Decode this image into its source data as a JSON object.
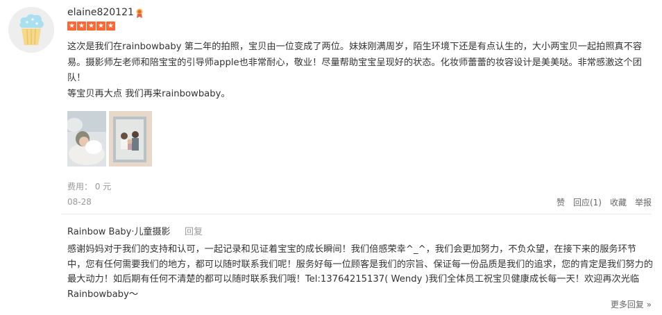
{
  "review": {
    "username": "elaine820121",
    "vip_icon": "vip-badge-icon",
    "rating": 5,
    "text_lines": [
      "这次是我们在rainbowbaby 第二年的拍照，宝贝由一位变成了两位。妹妹刚满周岁，陌生环境下还是有点认生的，大小两宝贝一起拍照真不容易。摄影师左老师和陪宝宝的引导师apple也非常耐心，敬业！尽量帮助宝宝呈现好的状态。化妆师蕾蕾的妆容设计是美美哒。非常感激这个团队！",
      "等宝贝再大点 我们再来rainbowbaby。"
    ],
    "cost": "费用： 0 元",
    "date": "08-28",
    "actions": {
      "like": "赞",
      "reply": "回应(1)",
      "favorite": "收藏",
      "report": "举报"
    }
  },
  "merchant_reply": {
    "name": "Rainbow Baby·儿童摄影",
    "reply_link": "回复",
    "text": "感谢妈妈对于我们的支持和认可，一起记录和见证着宝宝的成长瞬间！我们倍感荣幸^_^，我们会更加努力，不负众望，在接下来的服务环节中，您有任何需要我们的地方，都可以随时联系我们呢！服务好每一位顾客是我们的宗旨、保证每一份品质是我们的追求，您的肯定是我们努力的最大动力！如后期有任何不清楚的都可以随时联系我们哦！Tel:13764215137( Wendy )我们全体员工祝宝贝健康成长每一天！欢迎再次光临Rainbowbaby～",
    "more_replies": "更多回复 »"
  },
  "colors": {
    "star": "#ff6633",
    "text": "#333333",
    "muted": "#999999",
    "avatar_bg": "#eeeeee"
  }
}
